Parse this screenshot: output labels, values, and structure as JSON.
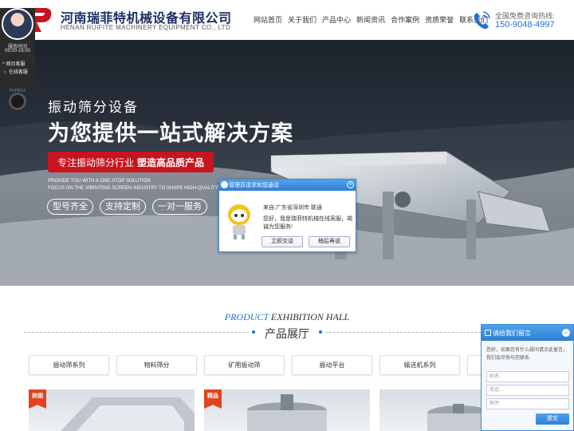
{
  "header": {
    "company_cn": "河南瑞菲特机械设备有限公司",
    "company_en": "HENAN RUIFITE MACHINERY EQUIPMENT CO., LTD",
    "nav": [
      "网站首页",
      "关于我们",
      "产品中心",
      "新闻资讯",
      "合作案例",
      "资质荣誉",
      "联系我们"
    ],
    "hotline_label": "全国免费咨询热线:",
    "hotline_number": "150-9048-4997",
    "brand_color": "#1d2f66",
    "accent_color": "#1f6fd6"
  },
  "service_panel": {
    "time_label": "服务时间",
    "time": "09:00-18:00",
    "links": [
      "网页客服",
      "在线客服"
    ],
    "footer": "POPBOX"
  },
  "hero": {
    "subtitle": "振动筛分设备",
    "title": "为您提供一站式解决方案",
    "ribbon_normal": "专注振动筛分行业",
    "ribbon_bold": "塑造高品质产品",
    "en_line1": "PROVIDE YOU WITH A ONE-STOP SOLUTION",
    "en_line2": "FOCUS ON THE VIBRATING SCREEN INDUSTRY TO SHAPE HIGH-QUALITY PRO",
    "tags": [
      "型号齐全",
      "支持定制",
      "一对一服务"
    ],
    "ribbon_color": "#c8141e"
  },
  "invite": {
    "title": "管理员请求和您通话",
    "from": "来自:广东省深圳市 联通",
    "message": "您好，我是瑞菲特机械在线客服，竭诚为您服务!",
    "accept": "立即交谈",
    "later": "稍后再说"
  },
  "hall": {
    "title_en_a": "PRODUCT",
    "title_en_b": " EXHIBITION HALL",
    "title_cn": "产品展厅",
    "categories": [
      "振动筛系列",
      "物料筛分",
      "矿用振动筛",
      "振动平台",
      "输送机系列",
      ""
    ],
    "badges": [
      "热销",
      "精品",
      ""
    ]
  },
  "message_widget": {
    "title": "请给我们留言",
    "text": "您好，如果您有什么疑问请点此留言，我们会尽快与您联系.",
    "name_placeholder": "姓名:",
    "phone_placeholder": "电话:",
    "email_placeholder": "邮件:",
    "submit": "提交"
  }
}
